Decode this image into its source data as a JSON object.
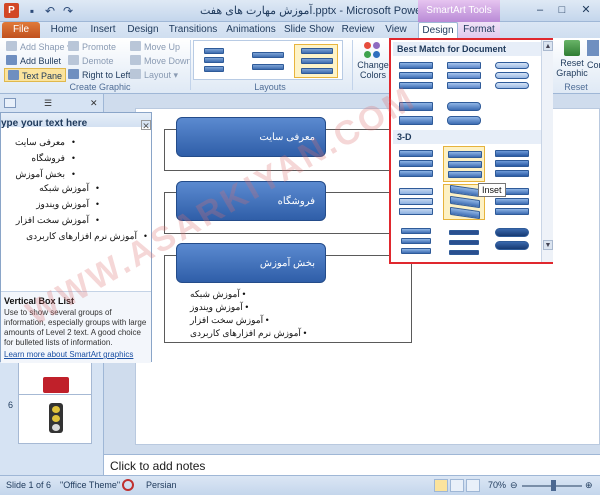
{
  "window": {
    "title": "آموزش مهارت های هفت.pptx - Microsoft PowerPoint",
    "contextual_tools": "SmartArt Tools",
    "qat_icons": [
      "save-icon",
      "undo-icon",
      "redo-icon"
    ],
    "controls": [
      "minimize",
      "maximize",
      "close"
    ]
  },
  "tabs": [
    "File",
    "Home",
    "Insert",
    "Design",
    "Transitions",
    "Animations",
    "Slide Show",
    "Review",
    "View",
    "Design",
    "Format"
  ],
  "ribbon": {
    "create_graphic": {
      "add_shape": "Add Shape",
      "add_bullet": "Add Bullet",
      "text_pane": "Text Pane",
      "promote": "Promote",
      "demote": "Demote",
      "right_to_left": "Right to Left",
      "move_up": "Move Up",
      "move_down": "Move Down",
      "layout": "Layout",
      "label": "Create Graphic"
    },
    "layouts_label": "Layouts",
    "change_colors": "Change Colors",
    "reset_graphic": "Reset Graphic",
    "reset_label": "Reset",
    "cut_text": "Cor"
  },
  "text_pane": {
    "title": "ype your text here",
    "bullets": [
      {
        "text": "معرفی سایت",
        "level": 1
      },
      {
        "text": "فروشگاه",
        "level": 1
      },
      {
        "text": "بخش آموزش",
        "level": 1
      },
      {
        "text": "آموزش شبکه",
        "level": 2
      },
      {
        "text": "آموزش ویندوز",
        "level": 2
      },
      {
        "text": "آموزش سخت افزار",
        "level": 2
      },
      {
        "text": "آموزش نرم افزارهای کاربردی",
        "level": 2
      }
    ],
    "desc_title": "Vertical Box List",
    "desc_text": "Use to show several groups of information, especially groups with large amounts of Level 2 text. A good choice for bulleted lists of information.",
    "learn_more": "Learn more about SmartArt graphics"
  },
  "slides": {
    "visible_numbers": [
      "6"
    ]
  },
  "slide": {
    "boxes": [
      "معرفی سایت",
      "فروشگاه",
      "بخش آموزش"
    ],
    "sub_bullets": [
      "آموزش شبکه",
      "آموزش ویندوز",
      "آموزش سخت افزار",
      "آموزش نرم افزارهای کاربردی"
    ]
  },
  "notes_placeholder": "Click to add notes",
  "gallery": {
    "header_best": "Best Match for Document",
    "header_3d": "3-D",
    "tooltip": "Inset"
  },
  "status": {
    "slide": "Slide 1 of 6",
    "theme": "\"Office Theme\"",
    "language": "Persian",
    "zoom": "70%",
    "zoom_level": 0.5
  },
  "watermark": "WWW.ASARKIYAN.COM",
  "colors": {
    "accent": "#2f5ea8",
    "highlight_border": "#e0282e",
    "file_tab": "#c0501f"
  }
}
